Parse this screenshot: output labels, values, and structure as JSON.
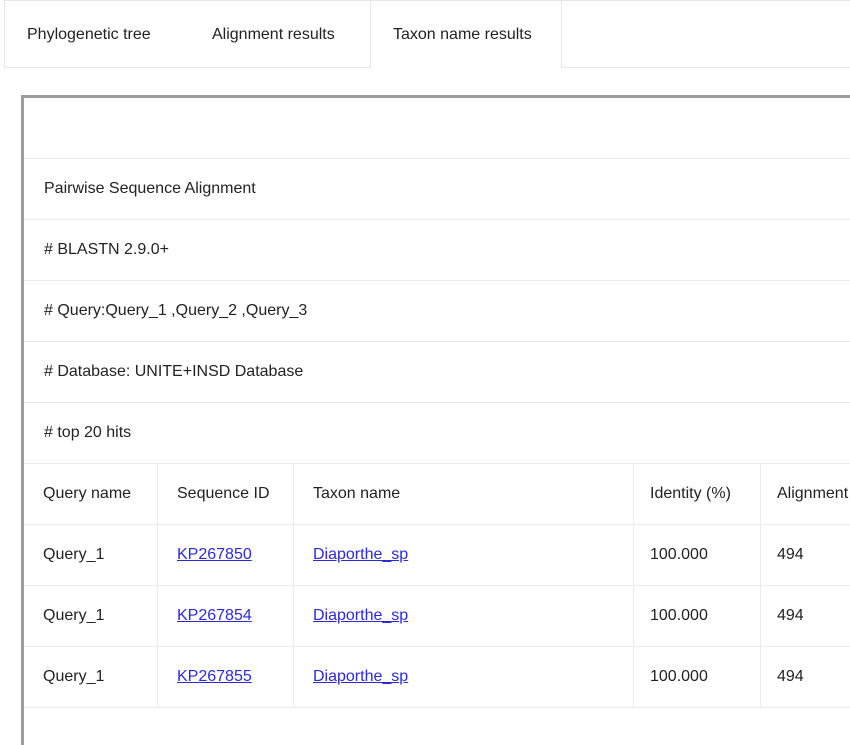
{
  "tabs": [
    {
      "label": "Phylogenetic tree"
    },
    {
      "label": "Alignment results"
    },
    {
      "label": "Taxon name results"
    }
  ],
  "info": {
    "line1": "Pairwise Sequence Alignment",
    "line2": "# BLASTN 2.9.0+",
    "line3": "# Query:Query_1 ,Query_2 ,Query_3",
    "line4": "# Database: UNITE+INSD Database",
    "line5": "# top 20 hits"
  },
  "table": {
    "headers": [
      "Query name",
      "Sequence ID",
      "Taxon name",
      "Identity (%)",
      "Alignment"
    ],
    "rows": [
      {
        "query": "Query_1",
        "seq_id": "KP267850",
        "taxon": "Diaporthe_sp",
        "identity": "100.000",
        "alignment": "494"
      },
      {
        "query": "Query_1",
        "seq_id": "KP267854",
        "taxon": "Diaporthe_sp",
        "identity": "100.000",
        "alignment": "494"
      },
      {
        "query": "Query_1",
        "seq_id": "KP267855",
        "taxon": "Diaporthe_sp",
        "identity": "100.000",
        "alignment": "494"
      }
    ]
  },
  "colors": {
    "link": "#2b2bd6",
    "panel_border": "#9c9c9c",
    "divider": "#ebebeb"
  }
}
